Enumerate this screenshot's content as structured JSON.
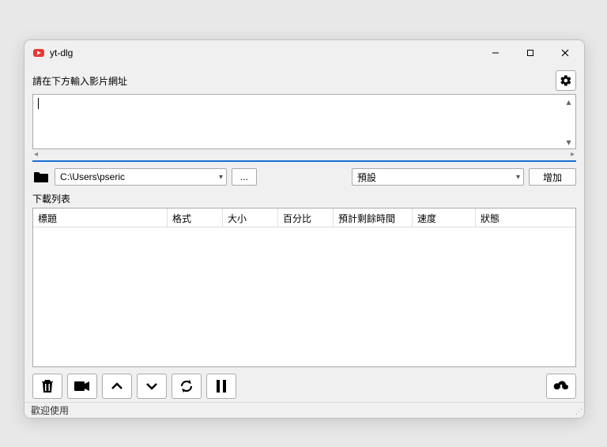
{
  "window": {
    "title": "yt-dlg"
  },
  "url_section": {
    "label": "請在下方輸入影片網址",
    "value": ""
  },
  "path": {
    "value": "C:\\Users\\pseric",
    "browse_label": "..."
  },
  "format": {
    "selected": "預設"
  },
  "add_button": {
    "label": "增加"
  },
  "list": {
    "label": "下載列表",
    "columns": [
      "標題",
      "格式",
      "大小",
      "百分比",
      "預計剩餘時間",
      "速度",
      "狀態"
    ],
    "rows": []
  },
  "status": "歡迎使用",
  "icons": {
    "gear": "gear",
    "folder": "folder",
    "trash": "trash",
    "camera": "camera",
    "up": "up",
    "down": "down",
    "refresh": "refresh",
    "pause": "pause",
    "download": "cloud-download"
  }
}
